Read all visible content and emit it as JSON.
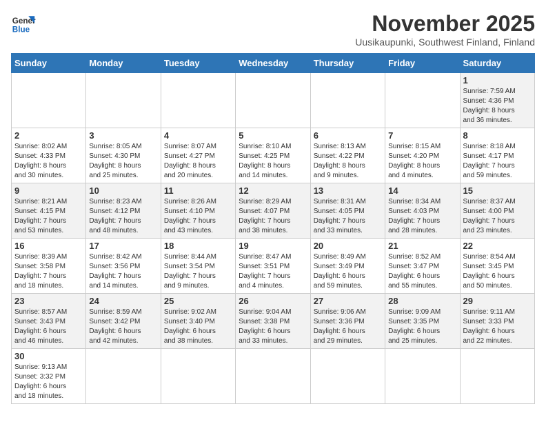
{
  "logo": {
    "line1": "General",
    "line2": "Blue"
  },
  "title": "November 2025",
  "subtitle": "Uusikaupunki, Southwest Finland, Finland",
  "weekdays": [
    "Sunday",
    "Monday",
    "Tuesday",
    "Wednesday",
    "Thursday",
    "Friday",
    "Saturday"
  ],
  "weeks": [
    [
      {
        "day": "",
        "info": ""
      },
      {
        "day": "",
        "info": ""
      },
      {
        "day": "",
        "info": ""
      },
      {
        "day": "",
        "info": ""
      },
      {
        "day": "",
        "info": ""
      },
      {
        "day": "",
        "info": ""
      },
      {
        "day": "1",
        "info": "Sunrise: 7:59 AM\nSunset: 4:36 PM\nDaylight: 8 hours\nand 36 minutes."
      }
    ],
    [
      {
        "day": "2",
        "info": "Sunrise: 8:02 AM\nSunset: 4:33 PM\nDaylight: 8 hours\nand 30 minutes."
      },
      {
        "day": "3",
        "info": "Sunrise: 8:05 AM\nSunset: 4:30 PM\nDaylight: 8 hours\nand 25 minutes."
      },
      {
        "day": "4",
        "info": "Sunrise: 8:07 AM\nSunset: 4:27 PM\nDaylight: 8 hours\nand 20 minutes."
      },
      {
        "day": "5",
        "info": "Sunrise: 8:10 AM\nSunset: 4:25 PM\nDaylight: 8 hours\nand 14 minutes."
      },
      {
        "day": "6",
        "info": "Sunrise: 8:13 AM\nSunset: 4:22 PM\nDaylight: 8 hours\nand 9 minutes."
      },
      {
        "day": "7",
        "info": "Sunrise: 8:15 AM\nSunset: 4:20 PM\nDaylight: 8 hours\nand 4 minutes."
      },
      {
        "day": "8",
        "info": "Sunrise: 8:18 AM\nSunset: 4:17 PM\nDaylight: 7 hours\nand 59 minutes."
      }
    ],
    [
      {
        "day": "9",
        "info": "Sunrise: 8:21 AM\nSunset: 4:15 PM\nDaylight: 7 hours\nand 53 minutes."
      },
      {
        "day": "10",
        "info": "Sunrise: 8:23 AM\nSunset: 4:12 PM\nDaylight: 7 hours\nand 48 minutes."
      },
      {
        "day": "11",
        "info": "Sunrise: 8:26 AM\nSunset: 4:10 PM\nDaylight: 7 hours\nand 43 minutes."
      },
      {
        "day": "12",
        "info": "Sunrise: 8:29 AM\nSunset: 4:07 PM\nDaylight: 7 hours\nand 38 minutes."
      },
      {
        "day": "13",
        "info": "Sunrise: 8:31 AM\nSunset: 4:05 PM\nDaylight: 7 hours\nand 33 minutes."
      },
      {
        "day": "14",
        "info": "Sunrise: 8:34 AM\nSunset: 4:03 PM\nDaylight: 7 hours\nand 28 minutes."
      },
      {
        "day": "15",
        "info": "Sunrise: 8:37 AM\nSunset: 4:00 PM\nDaylight: 7 hours\nand 23 minutes."
      }
    ],
    [
      {
        "day": "16",
        "info": "Sunrise: 8:39 AM\nSunset: 3:58 PM\nDaylight: 7 hours\nand 18 minutes."
      },
      {
        "day": "17",
        "info": "Sunrise: 8:42 AM\nSunset: 3:56 PM\nDaylight: 7 hours\nand 14 minutes."
      },
      {
        "day": "18",
        "info": "Sunrise: 8:44 AM\nSunset: 3:54 PM\nDaylight: 7 hours\nand 9 minutes."
      },
      {
        "day": "19",
        "info": "Sunrise: 8:47 AM\nSunset: 3:51 PM\nDaylight: 7 hours\nand 4 minutes."
      },
      {
        "day": "20",
        "info": "Sunrise: 8:49 AM\nSunset: 3:49 PM\nDaylight: 6 hours\nand 59 minutes."
      },
      {
        "day": "21",
        "info": "Sunrise: 8:52 AM\nSunset: 3:47 PM\nDaylight: 6 hours\nand 55 minutes."
      },
      {
        "day": "22",
        "info": "Sunrise: 8:54 AM\nSunset: 3:45 PM\nDaylight: 6 hours\nand 50 minutes."
      }
    ],
    [
      {
        "day": "23",
        "info": "Sunrise: 8:57 AM\nSunset: 3:43 PM\nDaylight: 6 hours\nand 46 minutes."
      },
      {
        "day": "24",
        "info": "Sunrise: 8:59 AM\nSunset: 3:42 PM\nDaylight: 6 hours\nand 42 minutes."
      },
      {
        "day": "25",
        "info": "Sunrise: 9:02 AM\nSunset: 3:40 PM\nDaylight: 6 hours\nand 38 minutes."
      },
      {
        "day": "26",
        "info": "Sunrise: 9:04 AM\nSunset: 3:38 PM\nDaylight: 6 hours\nand 33 minutes."
      },
      {
        "day": "27",
        "info": "Sunrise: 9:06 AM\nSunset: 3:36 PM\nDaylight: 6 hours\nand 29 minutes."
      },
      {
        "day": "28",
        "info": "Sunrise: 9:09 AM\nSunset: 3:35 PM\nDaylight: 6 hours\nand 25 minutes."
      },
      {
        "day": "29",
        "info": "Sunrise: 9:11 AM\nSunset: 3:33 PM\nDaylight: 6 hours\nand 22 minutes."
      }
    ],
    [
      {
        "day": "30",
        "info": "Sunrise: 9:13 AM\nSunset: 3:32 PM\nDaylight: 6 hours\nand 18 minutes."
      },
      {
        "day": "",
        "info": ""
      },
      {
        "day": "",
        "info": ""
      },
      {
        "day": "",
        "info": ""
      },
      {
        "day": "",
        "info": ""
      },
      {
        "day": "",
        "info": ""
      },
      {
        "day": "",
        "info": ""
      }
    ]
  ]
}
